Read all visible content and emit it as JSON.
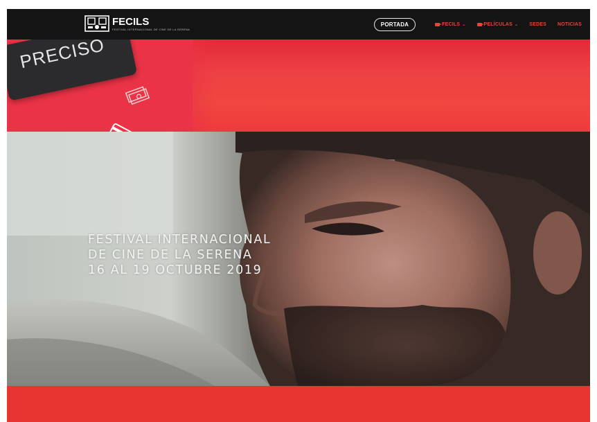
{
  "header": {
    "logo": {
      "name": "FECILS",
      "tagline": "FESTIVAL INTERNACIONAL DE CINE DE LA SERENA",
      "icon": "film-projector-logo-icon"
    },
    "nav": {
      "active_button": "PORTADA",
      "items": [
        {
          "label": "FECILS",
          "icon": "camera-icon",
          "has_dropdown": true
        },
        {
          "label": "PELÍCULAS",
          "icon": "camera-icon",
          "has_dropdown": true
        },
        {
          "label": "SEDES",
          "has_dropdown": false
        },
        {
          "label": "NOTICIAS",
          "has_dropdown": false
        }
      ]
    }
  },
  "banner": {
    "ticket_text": "PRECISO",
    "icons": [
      "money-bills-icon",
      "credit-card-icon"
    ]
  },
  "hero": {
    "title_lines": [
      "FESTIVAL INTERNACIONAL",
      "DE CINE DE LA SERENA",
      "16 AL 19 OCTUBRE 2019"
    ]
  },
  "colors": {
    "brand_red": "#e8352f",
    "nav_bg": "#141414",
    "nav_link": "#e8453c"
  }
}
